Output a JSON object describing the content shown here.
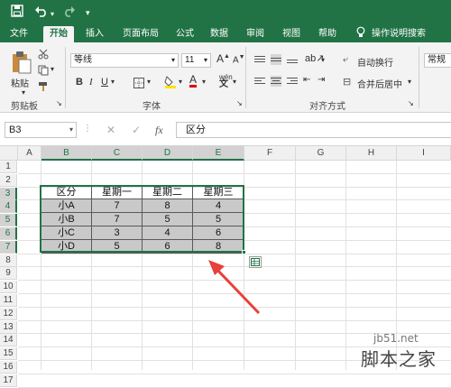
{
  "ribbon_tabs": [
    "文件",
    "开始",
    "插入",
    "页面布局",
    "公式",
    "数据",
    "审阅",
    "视图",
    "帮助",
    "操作说明搜索"
  ],
  "clipboard": {
    "paste_label": "粘贴",
    "group_label": "剪贴板"
  },
  "font": {
    "name": "等线",
    "size": "11",
    "group_label": "字体",
    "phonetic_label": "wén"
  },
  "alignment": {
    "wrap_text": "自动换行",
    "merge_center": "合并后居中",
    "group_label": "对齐方式"
  },
  "number": {
    "format": "常规"
  },
  "formula_bar": {
    "name_box": "B3",
    "fx": "fx",
    "content": "区分"
  },
  "columns": [
    "A",
    "B",
    "C",
    "D",
    "E",
    "F",
    "G",
    "H",
    "I"
  ],
  "rows": [
    "1",
    "2",
    "3",
    "4",
    "5",
    "6",
    "7",
    "8",
    "9",
    "10",
    "11",
    "12",
    "13",
    "14",
    "15",
    "16",
    "17"
  ],
  "table": {
    "header": [
      "区分",
      "星期一",
      "星期二",
      "星期三"
    ],
    "rows": [
      [
        "小A",
        "7",
        "8",
        "4"
      ],
      [
        "小B",
        "7",
        "5",
        "5"
      ],
      [
        "小C",
        "3",
        "4",
        "6"
      ],
      [
        "小D",
        "5",
        "6",
        "8"
      ]
    ]
  },
  "watermark": {
    "line1": "jb51.net",
    "line2": "脚本之家"
  },
  "colors": {
    "accent": "#217346",
    "arrow": "#e8403a",
    "table_fill": "#c9c9c9"
  }
}
